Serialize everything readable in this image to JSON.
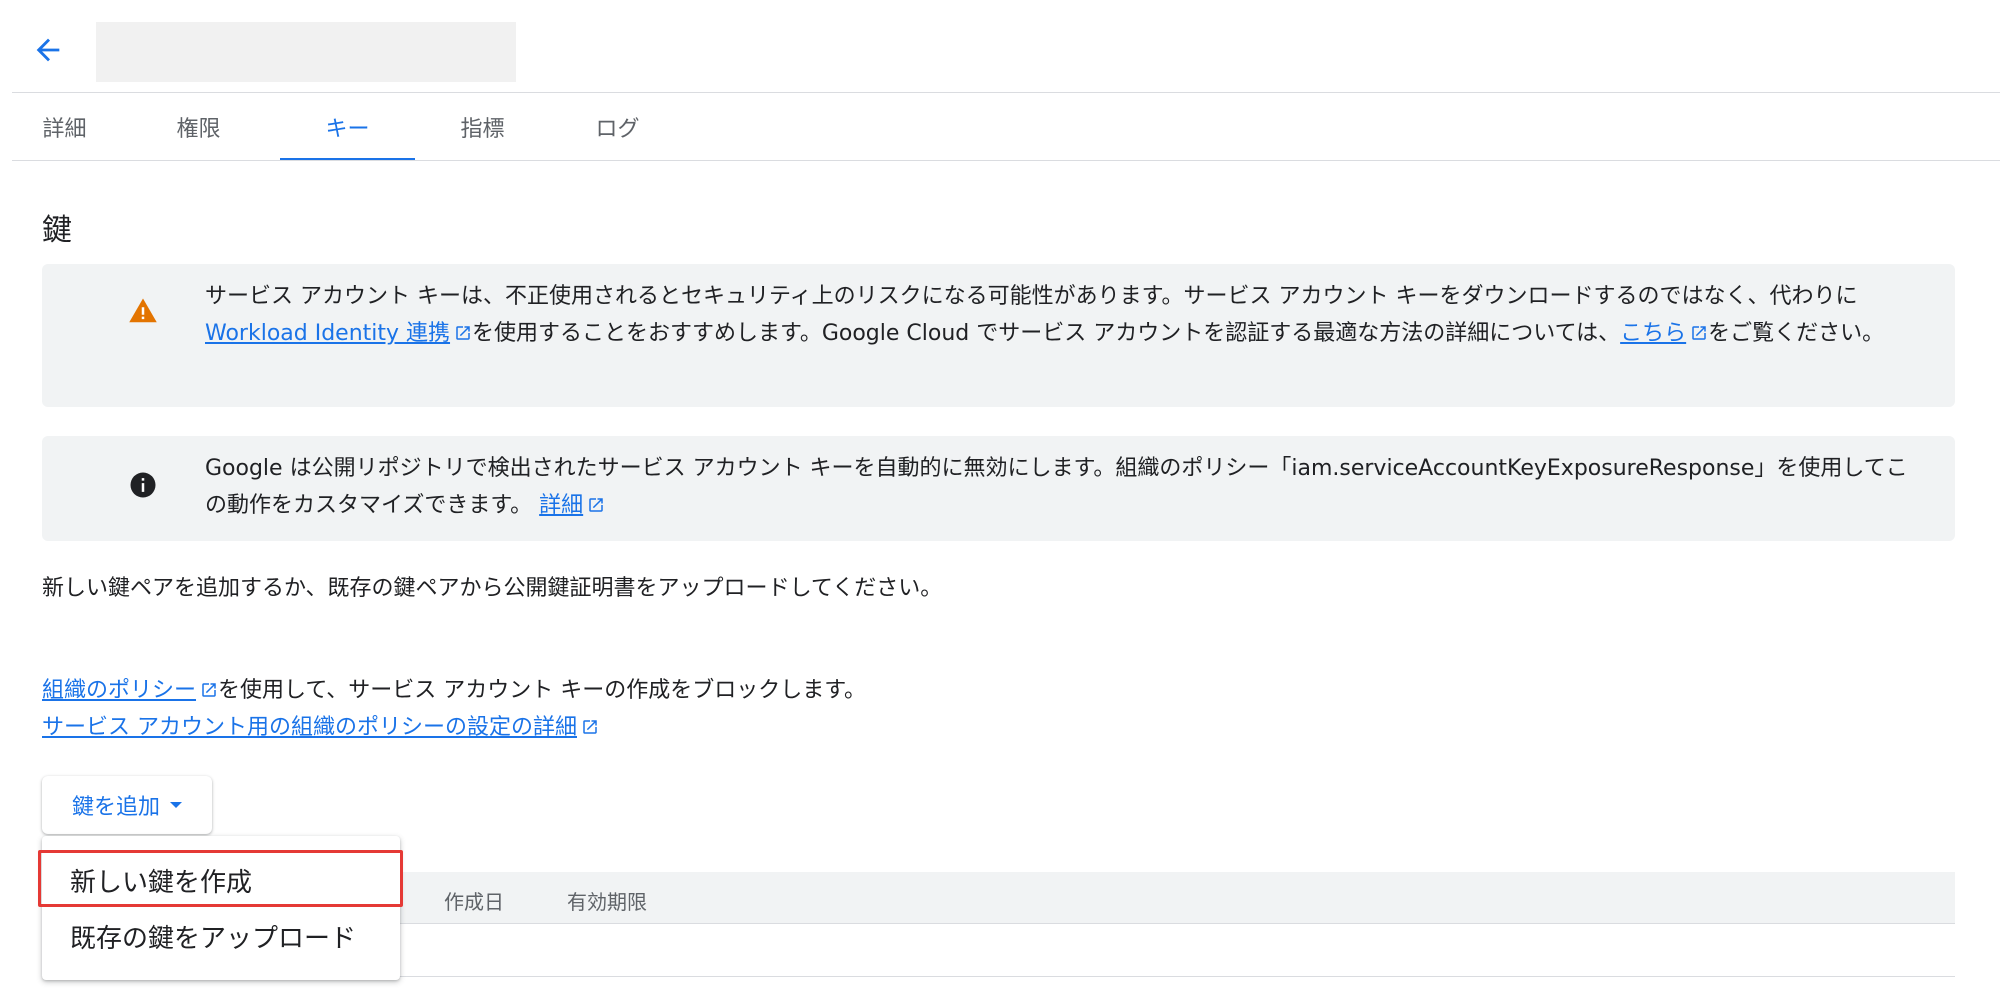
{
  "header": {
    "back_icon": "arrow-back-icon"
  },
  "tabs": [
    {
      "label": "詳細"
    },
    {
      "label": "権限"
    },
    {
      "label": "キー"
    },
    {
      "label": "指標"
    },
    {
      "label": "ログ"
    }
  ],
  "active_tab": "キー",
  "section_title": "鍵",
  "warning": {
    "icon": "warning-icon",
    "text_1": "サービス アカウント キーは、不正使用されるとセキュリティ上のリスクになる可能性があります。サービス アカウント キーをダウンロードするのではなく、代わりに ",
    "link_1": "Workload Identity 連携",
    "text_2": "を使用することをおすすめします。Google Cloud でサービス アカウントを認証する最適な方法の詳細については、",
    "link_2": "こちら",
    "text_3": "をご覧ください。"
  },
  "info": {
    "icon": "info-icon",
    "text_1": "Google は公開リポジトリで検出されたサービス アカウント キーを自動的に無効にします。組織のポリシー「iam.serviceAccountKeyExposureResponse」を使用してこの動作をカスタマイズできます。 ",
    "link": "詳細"
  },
  "description": "新しい鍵ペアを追加するか、既存の鍵ペアから公開鍵証明書をアップロードしてください。",
  "policy": {
    "link_1": "組織のポリシー",
    "text_1": "を使用して、サービス アカウント キーの作成をブロックします。",
    "link_2": "サービス アカウント用の組織のポリシーの設定の詳細"
  },
  "add_key_button": "鍵を追加",
  "menu": {
    "create_new_key": "新しい鍵を作成",
    "upload_existing_key": "既存の鍵をアップロード"
  },
  "table": {
    "columns": [
      "作成日",
      "有効期限"
    ]
  },
  "colors": {
    "accent": "#1a73e8",
    "warning": "#e37400",
    "highlight": "#e53935"
  }
}
